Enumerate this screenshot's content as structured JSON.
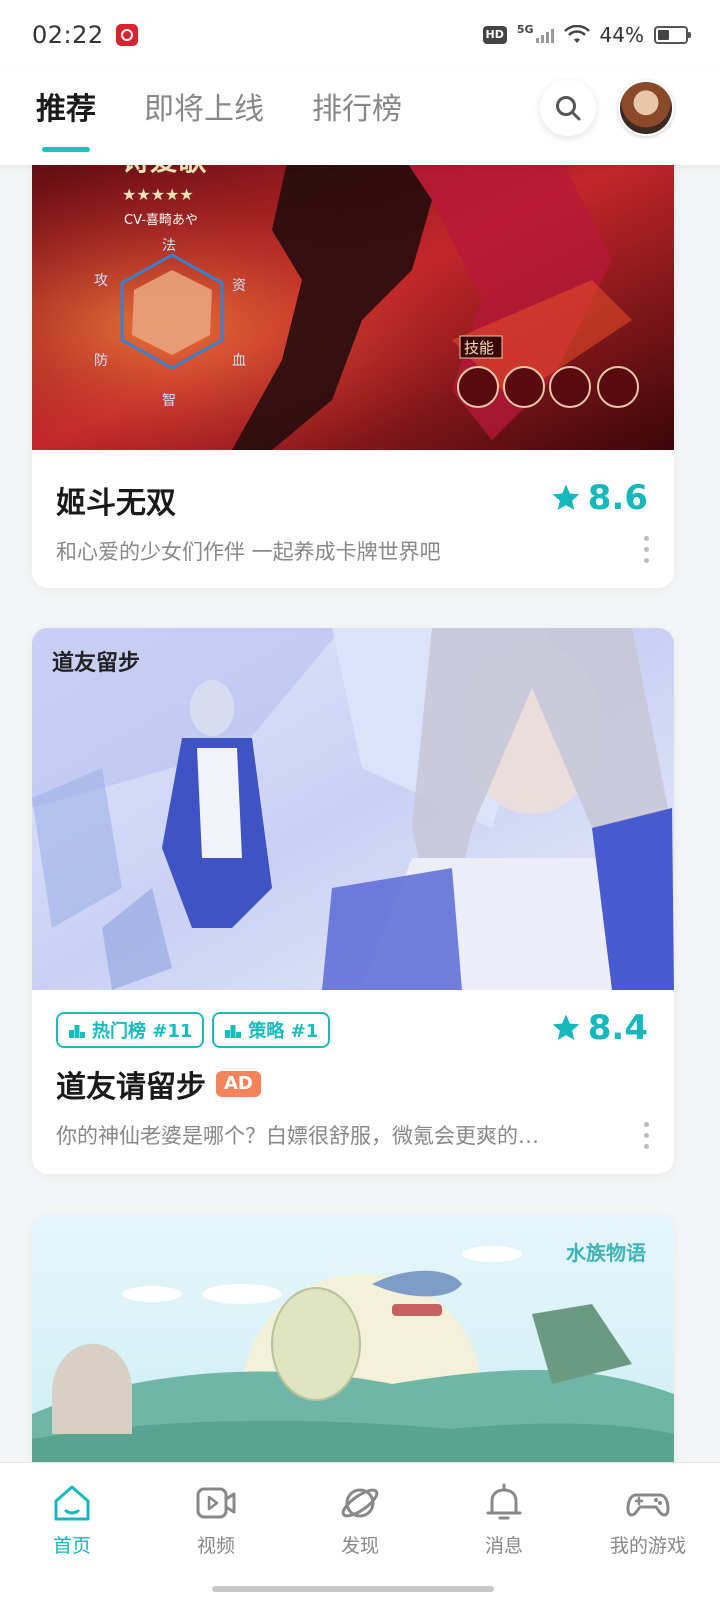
{
  "status_bar": {
    "time": "02:22",
    "hd": "HD",
    "network": "5G",
    "battery_percent": "44%",
    "battery_level": 0.44
  },
  "top_nav": {
    "tabs": [
      {
        "label": "推荐",
        "active": true
      },
      {
        "label": "即将上线",
        "active": false
      },
      {
        "label": "排行榜",
        "active": false
      }
    ],
    "search_icon": "search-icon",
    "avatar_icon": "avatar"
  },
  "cards": [
    {
      "title": "姬斗无双",
      "description": "和心爱的少女们作伴 一起养成卡牌世界吧",
      "rating": "8.6",
      "banner_text": {
        "heading": "诗爱歌",
        "cv": "CV-喜畸あや",
        "skill": "技能",
        "stats": [
          "法",
          "攻",
          "防",
          "智",
          "血",
          "资"
        ]
      }
    },
    {
      "title": "道友请留步",
      "ad": "AD",
      "description": "你的神仙老婆是哪个？白嫖很舒服，微氪会更爽的…",
      "rating": "8.4",
      "tags": [
        "热门榜 #11",
        "策略 #1"
      ],
      "banner_text": {
        "logo": "道友留步"
      }
    },
    {
      "banner_text": {
        "logo": "水族物语"
      }
    }
  ],
  "bottom_nav": {
    "items": [
      {
        "label": "首页",
        "icon": "home-icon",
        "active": true
      },
      {
        "label": "视频",
        "icon": "video-icon",
        "active": false
      },
      {
        "label": "发现",
        "icon": "planet-icon",
        "active": false
      },
      {
        "label": "消息",
        "icon": "bell-icon",
        "active": false
      },
      {
        "label": "我的游戏",
        "icon": "gamepad-icon",
        "active": false
      }
    ]
  },
  "colors": {
    "accent": "#15b8bd",
    "ad": "#f4845a"
  }
}
